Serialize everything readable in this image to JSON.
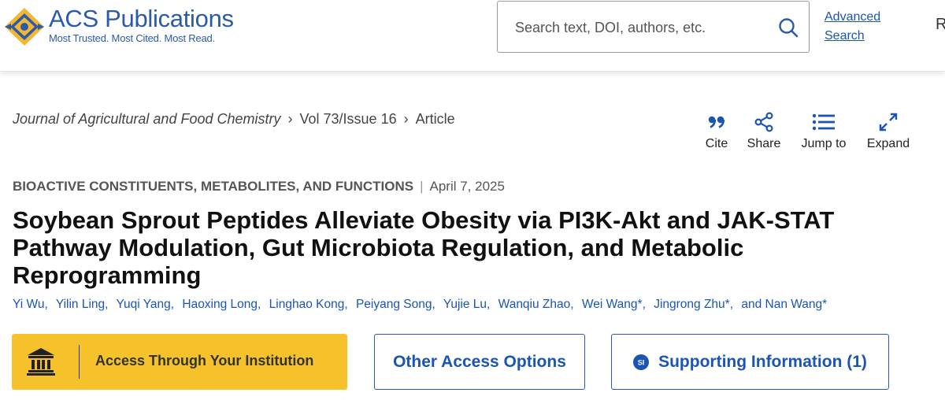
{
  "header": {
    "logo": {
      "brand_acs": "ACS",
      "brand_publications": "Publications",
      "tagline": "Most Trusted. Most Cited. Most Read."
    },
    "search": {
      "placeholder": "Search text, DOI, authors, etc.",
      "value": "",
      "icon": "search-icon"
    },
    "advanced_search": {
      "line1": "Advanced",
      "line2": "Search"
    },
    "cut_off_text": "R"
  },
  "breadcrumb": {
    "journal": "Journal of Agricultural and Food Chemistry",
    "issue": "Vol 73/Issue 16",
    "current": "Article"
  },
  "toolbar": {
    "cite": "Cite",
    "share": "Share",
    "jump_to": "Jump to",
    "expand": "Expand"
  },
  "article": {
    "section": "BIOACTIVE CONSTITUENTS, METABOLITES, AND FUNCTIONS",
    "separator": "|",
    "date": "April 7, 2025",
    "title": "Soybean Sprout Peptides Alleviate Obesity via PI3K-Akt and JAK-STAT Pathway Modulation, Gut Microbiota Regulation, and Metabolic Reprogramming",
    "authors": [
      "Yi Wu",
      "Yilin Ling",
      "Yuqi Yang",
      "Haoxing Long",
      "Linghao Kong",
      "Peiyang Song",
      "Yujie Lu",
      "Wanqiu Zhao",
      "Wei Wang*",
      "Jingrong Zhu*"
    ],
    "authors_and": "and",
    "last_author": "Nan Wang*"
  },
  "access": {
    "institution_label": "Access Through Your Institution",
    "other_label": "Other Access Options",
    "supporting_label": "Supporting Information (1)",
    "supporting_badge": "SI"
  },
  "colors": {
    "brand_blue": "#2b5aa8",
    "link_blue": "#1a55b3",
    "institution_yellow": "#f5c22b",
    "logo_gold": "#f2b632"
  }
}
